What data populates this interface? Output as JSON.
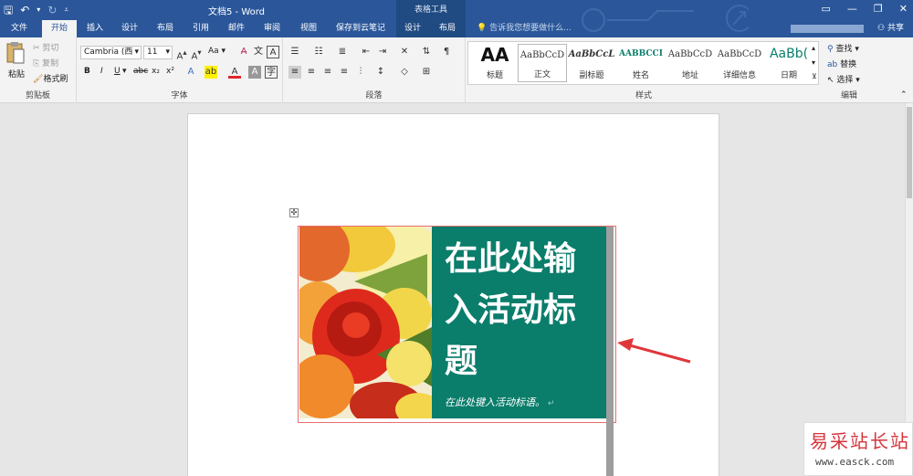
{
  "titlebar": {
    "doc_title": "文档5 - Word",
    "table_tools": "表格工具",
    "qat": {
      "save_icon": "save-icon",
      "undo_icon": "undo-icon",
      "redo_icon": "redo-icon",
      "customize_icon": "customize-icon"
    },
    "controls": [
      "▭",
      "—",
      "❐",
      "✕"
    ]
  },
  "tabs": [
    {
      "label": "文件"
    },
    {
      "label": "开始"
    },
    {
      "label": "插入"
    },
    {
      "label": "设计"
    },
    {
      "label": "布局"
    },
    {
      "label": "引用"
    },
    {
      "label": "邮件"
    },
    {
      "label": "审阅"
    },
    {
      "label": "视图"
    },
    {
      "label": "保存到云笔记"
    },
    {
      "label": "设计"
    },
    {
      "label": "布局"
    }
  ],
  "tell_me": "告诉我您想要做什么...",
  "share": "共享",
  "ribbon": {
    "clipboard": {
      "paste": "粘贴",
      "cut": "剪切",
      "copy": "复制",
      "format_painter": "格式刷",
      "label": "剪贴板"
    },
    "font": {
      "name": "Cambria (西",
      "size": "11",
      "label": "字体",
      "bold": "B",
      "italic": "I",
      "underline": "U",
      "strike": "abc",
      "sub": "x₂",
      "sup": "x²",
      "aa": "Aa"
    },
    "paragraph": {
      "label": "段落"
    },
    "styles": {
      "label": "样式",
      "items": [
        {
          "sample": "AA",
          "name": "标题"
        },
        {
          "sample": "AaBbCcD",
          "name": "正文"
        },
        {
          "sample": "AaBbCcL",
          "name": "副标题"
        },
        {
          "sample": "AABBCCI",
          "name": "姓名"
        },
        {
          "sample": "AaBbCcD",
          "name": "地址"
        },
        {
          "sample": "AaBbCcD",
          "name": "详细信息"
        },
        {
          "sample": "AaBb(",
          "name": "日期"
        }
      ]
    },
    "editing": {
      "find": "查找",
      "replace": "替换",
      "select": "选择",
      "label": "编辑"
    }
  },
  "document": {
    "heading_lines": [
      "在此处输",
      "入活动标",
      "题"
    ],
    "subtitle": "在此处键入活动标语。",
    "colors": {
      "panel": "#0a7d6b",
      "accent": "#e0363b"
    }
  },
  "watermark": {
    "title": "易采站长站",
    "url": "www.easck.com"
  }
}
